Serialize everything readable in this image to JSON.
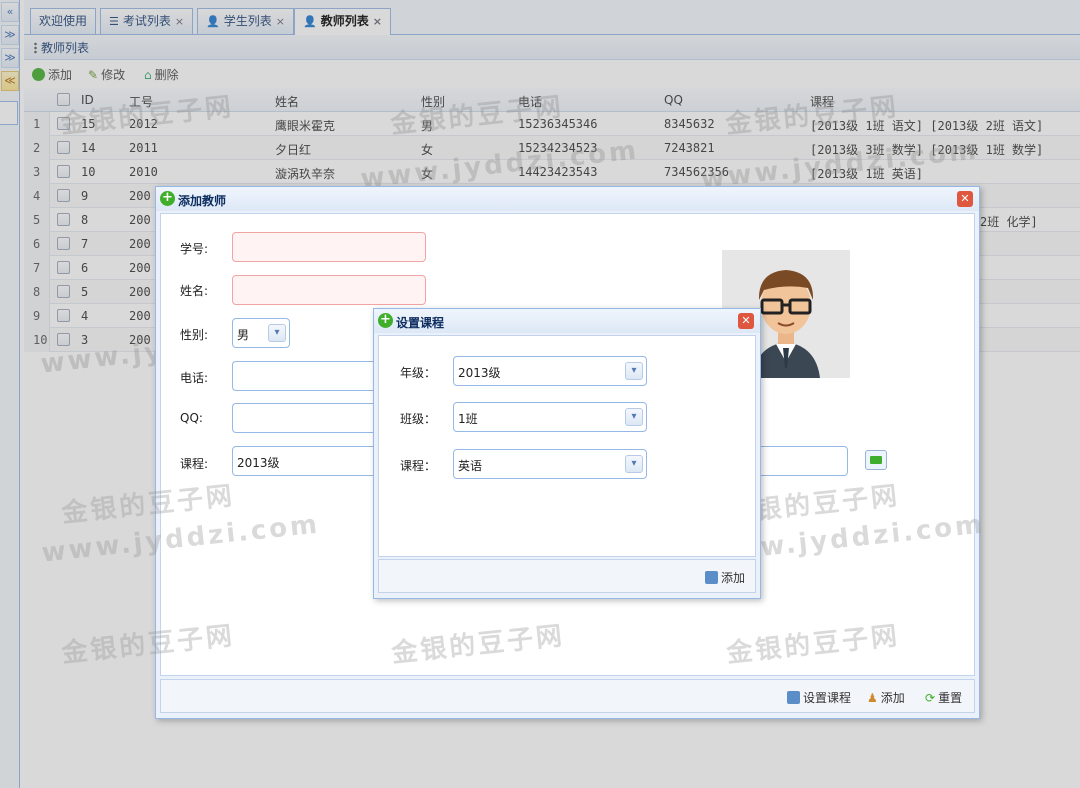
{
  "left_strip": {
    "buttons": [
      "«",
      "≫",
      "≫",
      "≪"
    ]
  },
  "tabs": [
    {
      "label": "欢迎使用",
      "closable": false
    },
    {
      "label": "考试列表",
      "closable": true
    },
    {
      "label": "学生列表",
      "closable": true
    },
    {
      "label": "教师列表",
      "closable": true,
      "active": true
    }
  ],
  "panel": {
    "title": "教师列表"
  },
  "toolbar": {
    "add": "添加",
    "edit": "修改",
    "delete": "删除"
  },
  "grid": {
    "columns": [
      "ID",
      "工号",
      "姓名",
      "性别",
      "电话",
      "QQ",
      "课程"
    ],
    "rows": [
      {
        "n": "1",
        "id": "15",
        "no": "2012",
        "name": "鹰眼米霍克",
        "sex": "男",
        "phone": "15236345346",
        "qq": "8345632",
        "course": "[2013级 1班 语文]  [2013级 2班 语文]"
      },
      {
        "n": "2",
        "id": "14",
        "no": "2011",
        "name": "夕日红",
        "sex": "女",
        "phone": "15234234523",
        "qq": "7243821",
        "course": "[2013级 3班 数学]  [2013级 1班 数学]"
      },
      {
        "n": "3",
        "id": "10",
        "no": "2010",
        "name": "漩涡玖辛奈",
        "sex": "女",
        "phone": "14423423543",
        "qq": "734562356",
        "course": "[2013级 1班 英语]"
      },
      {
        "n": "4",
        "id": "9",
        "no": "200",
        "name": "",
        "sex": "",
        "phone": "",
        "qq": "",
        "course": ""
      },
      {
        "n": "5",
        "id": "8",
        "no": "200",
        "name": "",
        "sex": "",
        "phone": "",
        "qq": "",
        "course": "2班 化学]"
      },
      {
        "n": "6",
        "id": "7",
        "no": "200",
        "name": "",
        "sex": "",
        "phone": "",
        "qq": "",
        "course": ""
      },
      {
        "n": "7",
        "id": "6",
        "no": "200",
        "name": "",
        "sex": "",
        "phone": "",
        "qq": "",
        "course": ""
      },
      {
        "n": "8",
        "id": "5",
        "no": "200",
        "name": "",
        "sex": "",
        "phone": "",
        "qq": "",
        "course": ""
      },
      {
        "n": "9",
        "id": "4",
        "no": "200",
        "name": "",
        "sex": "",
        "phone": "",
        "qq": "",
        "course": ""
      },
      {
        "n": "10",
        "id": "3",
        "no": "200",
        "name": "",
        "sex": "",
        "phone": "",
        "qq": "",
        "course": ""
      }
    ]
  },
  "add_dialog": {
    "title": "添加教师",
    "labels": {
      "no": "学号:",
      "name": "姓名:",
      "sex": "性别:",
      "phone": "电话:",
      "qq": "QQ:",
      "course": "课程:"
    },
    "sex_value": "男",
    "course_value": "2013级",
    "footer": {
      "set_course": "设置课程",
      "add": "添加",
      "reset": "重置"
    }
  },
  "course_dialog": {
    "title": "设置课程",
    "grade_label": "年级：",
    "grade_value": "2013级",
    "class_label": "班级：",
    "class_value": "1班",
    "course_label": "课程：",
    "course_value": "英语",
    "add_button": "添加"
  },
  "watermark": {
    "line1": "金银的豆子网",
    "line2": "www.jyddzi.com"
  },
  "colors": {
    "border": "#95b8e7",
    "header": "#0e2d5f",
    "invalid_bg": "#fff3f3",
    "close": "#e0573f",
    "plus": "#3fae2a"
  }
}
